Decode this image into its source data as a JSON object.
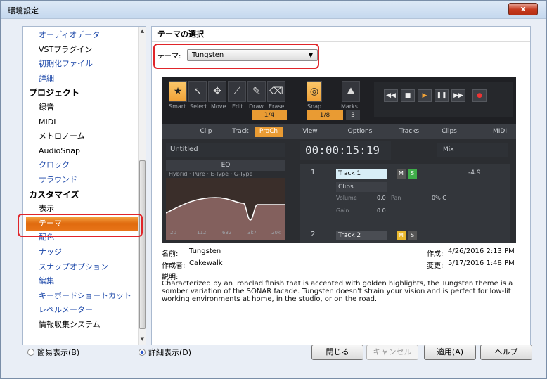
{
  "window": {
    "title": "環境設定",
    "close_label": "x"
  },
  "nav": {
    "items": [
      {
        "label": "オーディオデータ",
        "kind": "item"
      },
      {
        "label": "VSTプラグイン",
        "kind": "item-plain"
      },
      {
        "label": "初期化ファイル",
        "kind": "item"
      },
      {
        "label": "詳細",
        "kind": "item"
      },
      {
        "label": "プロジェクト",
        "kind": "section"
      },
      {
        "label": "録音",
        "kind": "item-plain"
      },
      {
        "label": "MIDI",
        "kind": "item-plain"
      },
      {
        "label": "メトロノーム",
        "kind": "item-plain"
      },
      {
        "label": "AudioSnap",
        "kind": "item-plain"
      },
      {
        "label": "クロック",
        "kind": "item"
      },
      {
        "label": "サラウンド",
        "kind": "item"
      },
      {
        "label": "カスタマイズ",
        "kind": "section"
      },
      {
        "label": "表示",
        "kind": "item-plain"
      },
      {
        "label": "テーマ",
        "kind": "selected"
      },
      {
        "label": "配色",
        "kind": "item"
      },
      {
        "label": "ナッジ",
        "kind": "item"
      },
      {
        "label": "スナップオプション",
        "kind": "item"
      },
      {
        "label": "編集",
        "kind": "item"
      },
      {
        "label": "キーボードショートカット",
        "kind": "item"
      },
      {
        "label": "レベルメーター",
        "kind": "item"
      },
      {
        "label": "情報収集システム",
        "kind": "item-plain"
      }
    ]
  },
  "content": {
    "title": "テーマの選択",
    "theme_label": "テーマ:",
    "theme_value": "Tungsten",
    "preview": {
      "tools": [
        "Smart",
        "Select",
        "Move",
        "Edit",
        "Draw",
        "Erase"
      ],
      "snap_label": "Snap",
      "marks_label": "Marks",
      "snap_value": "1/4",
      "snap_value2": "1/8",
      "snap_num": "3",
      "tabs": [
        "Clip",
        "Track",
        "ProCh",
        "View",
        "Options",
        "Tracks",
        "Clips",
        "MIDI"
      ],
      "untitled": "Untitled",
      "eq_label": "EQ",
      "eq_modes": [
        "Hybrid",
        "Pure",
        "E-Type",
        "G-Type"
      ],
      "eq_freqs": [
        "20",
        "112",
        "632",
        "3k7",
        "20k"
      ],
      "time": "00:00:15:19",
      "mix": "Mix",
      "track1": "Track 1",
      "track2": "Track 2",
      "clips": "Clips",
      "volume_label": "Volume",
      "volume_value": "0.0",
      "pan_label": "Pan",
      "pan_value": "0% C",
      "gain_label": "Gain",
      "gain_value": "0.0",
      "level": "-4.9",
      "track1_num": "1",
      "track2_num": "2"
    },
    "name_label": "名前:",
    "name_value": "Tungsten",
    "author_label": "作成者:",
    "author_value": "Cakewalk",
    "created_label": "作成:",
    "created_value": "4/26/2016 2:13 PM",
    "modified_label": "変更:",
    "modified_value": "5/17/2016 1:48 PM",
    "desc_label": "説明:",
    "desc_text": "Characterized by an ironclad finish that is accented with golden highlights, the Tungsten theme is a somber variation of the SONAR facade. Tungsten doesn't strain your vision and is perfect for low-lit working environments at home, in the studio, or on the road."
  },
  "footer": {
    "simple_view": "簡易表示(B)",
    "detail_view": "詳細表示(D)",
    "close": "閉じる",
    "cancel": "キャンセル",
    "apply": "適用(A)",
    "help": "ヘルプ"
  }
}
